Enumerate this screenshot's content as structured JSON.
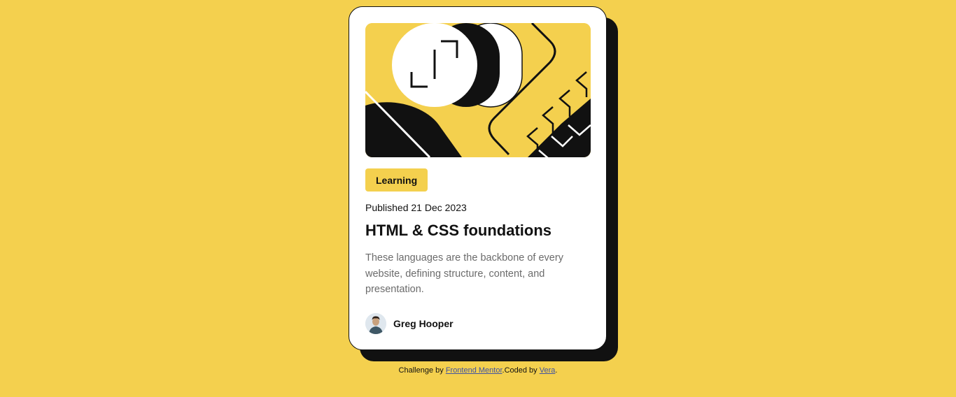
{
  "card": {
    "image_alt": "illustration-article",
    "tag": "Learning",
    "published": "Published 21 Dec 2023",
    "title": "HTML & CSS foundations",
    "description": "These languages are the backbone of every website, defining structure, content, and presentation.",
    "author": {
      "name": "Greg Hooper",
      "avatar": "avatar-image"
    }
  },
  "attribution": {
    "prefix": "Challenge by",
    "link1": "Frontend Mentor",
    "middle": ".Coded by",
    "link2": "Vera",
    "suffix": "."
  },
  "colors": {
    "background": "#F4D04E",
    "accent": "#F4D04E",
    "ink": "#111111",
    "muted": "#6B6B6B",
    "card": "#FFFFFF"
  }
}
